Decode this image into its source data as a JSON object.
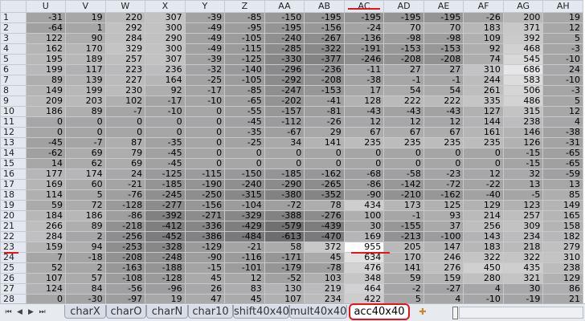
{
  "spreadsheet": {
    "columns": [
      "U",
      "V",
      "W",
      "X",
      "Y",
      "Z",
      "AA",
      "AB",
      "AC",
      "AD",
      "AE",
      "AF",
      "AG",
      "AH"
    ],
    "row_numbers": [
      "1",
      "2",
      "3",
      "4",
      "5",
      "6",
      "7",
      "8",
      "9",
      "10",
      "11",
      "12",
      "13",
      "14",
      "15",
      "16",
      "17",
      "18",
      "19",
      "20",
      "21",
      "22",
      "23",
      "24",
      "25",
      "26",
      "27",
      "28"
    ],
    "rows": [
      [
        "-31",
        "19",
        "220",
        "307",
        "-39",
        "-85",
        "-150",
        "-195",
        "-195",
        "-195",
        "-195",
        "-26",
        "200",
        "19"
      ],
      [
        "-64",
        "1",
        "292",
        "300",
        "-49",
        "-95",
        "-195",
        "-156",
        "-24",
        "70",
        "70",
        "183",
        "371",
        "12"
      ],
      [
        "122",
        "90",
        "284",
        "290",
        "-49",
        "-105",
        "-240",
        "-267",
        "-136",
        "-98",
        "-98",
        "109",
        "392",
        "5"
      ],
      [
        "162",
        "170",
        "329",
        "300",
        "-49",
        "-115",
        "-285",
        "-322",
        "-191",
        "-153",
        "-153",
        "92",
        "468",
        "-3"
      ],
      [
        "195",
        "189",
        "257",
        "307",
        "-39",
        "-125",
        "-330",
        "-377",
        "-246",
        "-208",
        "-208",
        "74",
        "545",
        "-10"
      ],
      [
        "199",
        "117",
        "223",
        "236",
        "-32",
        "-140",
        "-296",
        "-236",
        "-11",
        "27",
        "27",
        "310",
        "686",
        "24"
      ],
      [
        "89",
        "139",
        "227",
        "164",
        "-25",
        "-105",
        "-292",
        "-208",
        "-38",
        "-1",
        "-1",
        "244",
        "583",
        "-10"
      ],
      [
        "149",
        "199",
        "230",
        "92",
        "-17",
        "-85",
        "-247",
        "-153",
        "17",
        "54",
        "54",
        "261",
        "506",
        "-3"
      ],
      [
        "209",
        "203",
        "102",
        "-17",
        "-10",
        "-65",
        "-202",
        "-41",
        "128",
        "222",
        "222",
        "335",
        "486",
        "5"
      ],
      [
        "186",
        "89",
        "-7",
        "-10",
        "0",
        "-55",
        "-157",
        "-81",
        "-43",
        "-43",
        "-43",
        "127",
        "315",
        "12"
      ],
      [
        "0",
        "0",
        "0",
        "0",
        "0",
        "-45",
        "-112",
        "-26",
        "12",
        "12",
        "12",
        "144",
        "238",
        "4"
      ],
      [
        "0",
        "0",
        "0",
        "0",
        "0",
        "-35",
        "-67",
        "29",
        "67",
        "67",
        "67",
        "161",
        "146",
        "-38"
      ],
      [
        "-45",
        "-7",
        "87",
        "-35",
        "0",
        "-25",
        "34",
        "141",
        "235",
        "235",
        "235",
        "235",
        "126",
        "-31"
      ],
      [
        "-62",
        "69",
        "79",
        "-45",
        "0",
        "0",
        "0",
        "0",
        "0",
        "0",
        "0",
        "0",
        "-15",
        "-65"
      ],
      [
        "14",
        "62",
        "69",
        "-45",
        "0",
        "0",
        "0",
        "0",
        "0",
        "0",
        "0",
        "0",
        "-15",
        "-65"
      ],
      [
        "177",
        "174",
        "24",
        "-125",
        "-115",
        "-150",
        "-185",
        "-162",
        "-68",
        "-58",
        "-23",
        "12",
        "32",
        "-59"
      ],
      [
        "169",
        "60",
        "-21",
        "-185",
        "-190",
        "-240",
        "-290",
        "-265",
        "-86",
        "-142",
        "-72",
        "-22",
        "13",
        "13"
      ],
      [
        "114",
        "5",
        "-76",
        "-245",
        "-250",
        "-315",
        "-380",
        "-352",
        "-90",
        "-210",
        "-162",
        "-40",
        "-5",
        "85"
      ],
      [
        "59",
        "72",
        "-128",
        "-277",
        "-156",
        "-104",
        "-72",
        "78",
        "434",
        "173",
        "125",
        "129",
        "123",
        "149"
      ],
      [
        "184",
        "186",
        "-86",
        "-392",
        "-271",
        "-329",
        "-388",
        "-276",
        "100",
        "-1",
        "93",
        "214",
        "257",
        "165"
      ],
      [
        "266",
        "89",
        "-218",
        "-412",
        "-336",
        "-429",
        "-579",
        "-439",
        "30",
        "-155",
        "37",
        "256",
        "309",
        "158"
      ],
      [
        "284",
        "2",
        "-256",
        "-452",
        "-386",
        "-484",
        "-613",
        "-470",
        "169",
        "-213",
        "-100",
        "143",
        "234",
        "182"
      ],
      [
        "159",
        "94",
        "-253",
        "-328",
        "-129",
        "-21",
        "58",
        "372",
        "955",
        "205",
        "147",
        "183",
        "218",
        "279"
      ],
      [
        "7",
        "-18",
        "-208",
        "-248",
        "-90",
        "-116",
        "-171",
        "45",
        "634",
        "170",
        "246",
        "322",
        "322",
        "310"
      ],
      [
        "52",
        "2",
        "-163",
        "-188",
        "-15",
        "-101",
        "-179",
        "-78",
        "476",
        "141",
        "276",
        "450",
        "435",
        "238"
      ],
      [
        "107",
        "57",
        "-108",
        "-128",
        "45",
        "12",
        "-52",
        "103",
        "348",
        "59",
        "159",
        "280",
        "321",
        "129"
      ],
      [
        "124",
        "84",
        "-56",
        "-96",
        "26",
        "83",
        "130",
        "219",
        "464",
        "-2",
        "-27",
        "4",
        "30",
        "86"
      ],
      [
        "0",
        "-30",
        "-97",
        "19",
        "47",
        "45",
        "107",
        "234",
        "422",
        "5",
        "4",
        "-10",
        "-19",
        "21"
      ]
    ]
  },
  "sheet_tabs": {
    "items": [
      "charX",
      "charO",
      "charN",
      "char10",
      "shift40x40",
      "mult40x40",
      "acc40x40"
    ],
    "active": "acc40x40"
  },
  "navigation": {
    "first": "⏮",
    "prev": "◀",
    "next": "▶",
    "last": "⏭"
  },
  "colors": {
    "marker": "#e2141c",
    "header_bg": "#e4e9f1"
  }
}
